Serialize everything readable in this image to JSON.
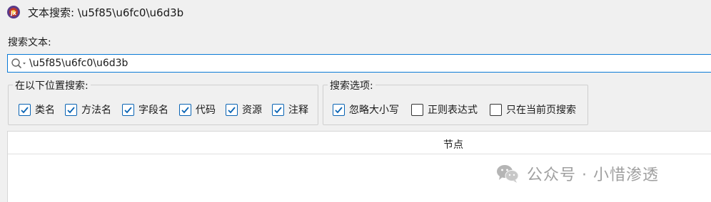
{
  "window": {
    "title": "文本搜索: \\u5f85\\u6fc0\\u6d3b"
  },
  "search": {
    "label": "搜索文本:",
    "value": "\\u5f85\\u6fc0\\u6d3b"
  },
  "location_group": {
    "title": "在以下位置搜索:",
    "options": [
      {
        "label": "类名",
        "checked": true
      },
      {
        "label": "方法名",
        "checked": true
      },
      {
        "label": "字段名",
        "checked": true
      },
      {
        "label": "代码",
        "checked": true
      },
      {
        "label": "资源",
        "checked": true
      },
      {
        "label": "注释",
        "checked": true
      }
    ]
  },
  "options_group": {
    "title": "搜索选项:",
    "options": [
      {
        "label": "忽略大小写",
        "checked": true
      },
      {
        "label": "正则表达式",
        "checked": false
      },
      {
        "label": "只在当前页搜索",
        "checked": false
      }
    ]
  },
  "results_table": {
    "column_header": "节点"
  },
  "watermark": {
    "text": "公众号 · 小惜渗透"
  },
  "colors": {
    "accent": "#0a7ad6",
    "background": "#f0f0f0"
  }
}
